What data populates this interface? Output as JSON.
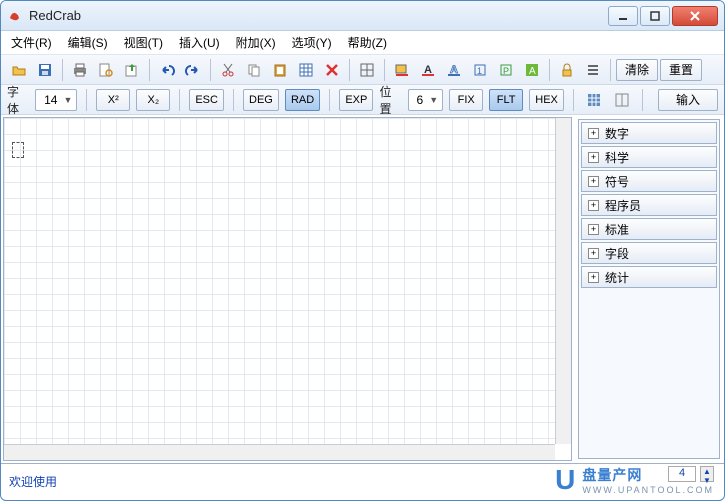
{
  "window": {
    "title": "RedCrab"
  },
  "menu": {
    "file": "文件(R)",
    "edit": "编辑(S)",
    "view": "视图(T)",
    "insert": "插入(U)",
    "attach": "附加(X)",
    "options": "选项(Y)",
    "help": "帮助(Z)"
  },
  "toolbar1": {
    "clear": "清除",
    "reset": "重置"
  },
  "toolbar2": {
    "font": "字体",
    "font_size": "14",
    "x2": "X²",
    "xsub2": "X₂",
    "esc": "ESC",
    "deg": "DEG",
    "rad": "RAD",
    "exp": "EXP",
    "pos": "位置",
    "pos_val": "6",
    "fix": "FIX",
    "flt": "FLT",
    "hex": "HEX",
    "input": "输入"
  },
  "sidebar": {
    "items": [
      {
        "label": "数字"
      },
      {
        "label": "科学"
      },
      {
        "label": "符号"
      },
      {
        "label": "程序员"
      },
      {
        "label": "标准"
      },
      {
        "label": "字段"
      },
      {
        "label": "统计"
      }
    ]
  },
  "status": {
    "welcome": "欢迎使用",
    "page": "4"
  },
  "watermark": {
    "brand": "盘量产网",
    "url": "WWW.UPANTOOL.COM"
  }
}
